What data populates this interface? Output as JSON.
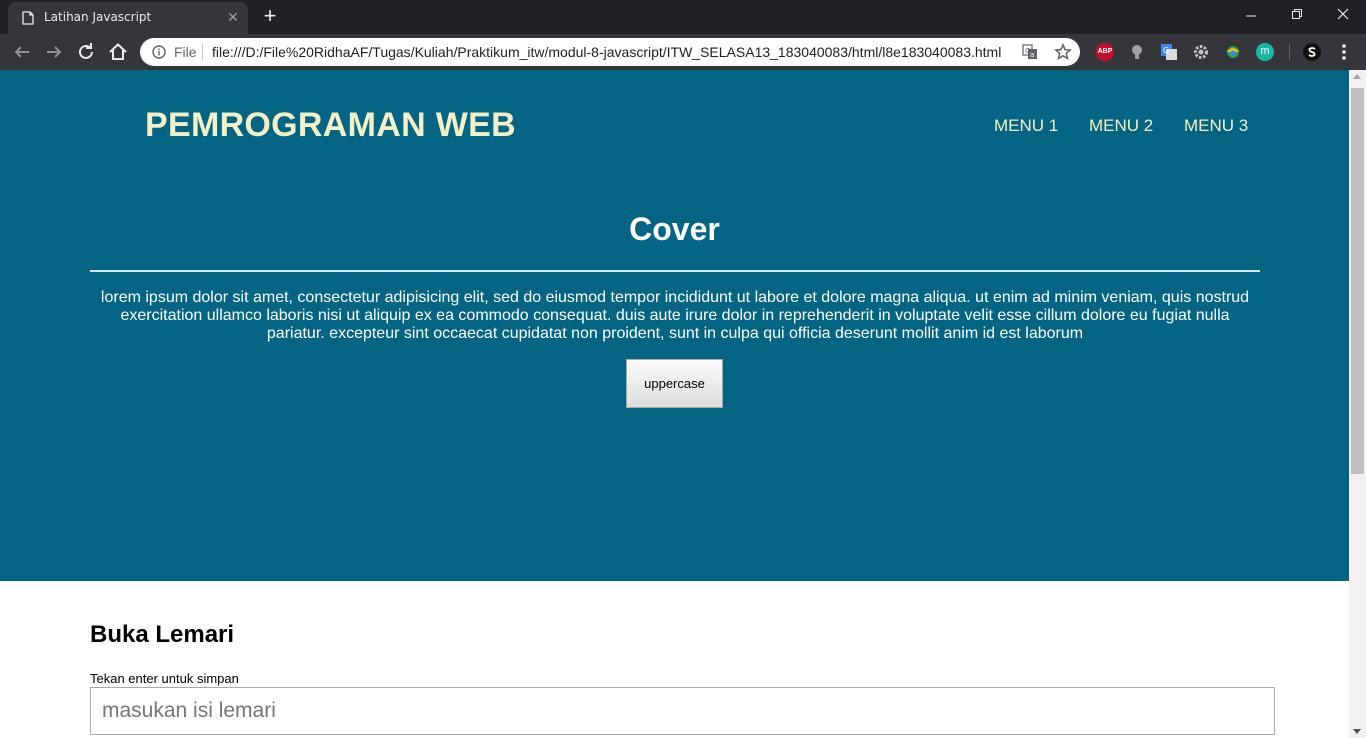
{
  "browser": {
    "tab_title": "Latihan Javascript",
    "new_tab_symbol": "+",
    "address_scheme_label": "File",
    "address_url": "file:///D:/File%20RidhaAF/Tugas/Kuliah/Praktikum_itw/modul-8-javascript/ITW_SELASA13_183040083/html/l8e183040083.html",
    "extensions": [
      {
        "icon": "adblock-plus-icon",
        "text": "ABP",
        "color": "#c70d2c"
      },
      {
        "icon": "lightbulb-extension-icon",
        "color": "#9aa0a6"
      },
      {
        "icon": "google-translate-extension-icon",
        "color": "#4285f4"
      },
      {
        "icon": "gear-extension-icon",
        "color": "#c4c4c4"
      },
      {
        "icon": "colorful-extension-icon",
        "color": "#2e9e4f"
      },
      {
        "icon": "m-extension-icon",
        "text": "m",
        "color": "#1ab7a6"
      },
      {
        "icon": "s-extension-icon",
        "color": "#111111"
      }
    ]
  },
  "header": {
    "brand": "PEMROGRAMAN WEB",
    "menu": [
      "MENU 1",
      "MENU 2",
      "MENU 3"
    ]
  },
  "cover": {
    "title": "Cover",
    "text": "lorem ipsum dolor sit amet, consectetur adipisicing elit, sed do eiusmod tempor incididunt ut labore et dolore magna aliqua. ut enim ad minim veniam, quis nostrud exercitation ullamco laboris nisi ut aliquip ex ea commodo consequat. duis aute irure dolor in reprehenderit in voluptate velit esse cillum dolore eu fugiat nulla pariatur. excepteur sint occaecat cupidatat non proident, sunt in culpa qui officia deserunt mollit anim id est laborum",
    "button_label": "uppercase"
  },
  "lemari": {
    "title": "Buka Lemari",
    "hint": "Tekan enter untuk simpan",
    "placeholder": "masukan isi lemari",
    "value": ""
  },
  "colors": {
    "hero_background": "#036583",
    "brand_text": "#f3efc6",
    "page_background": "#ffffff"
  }
}
